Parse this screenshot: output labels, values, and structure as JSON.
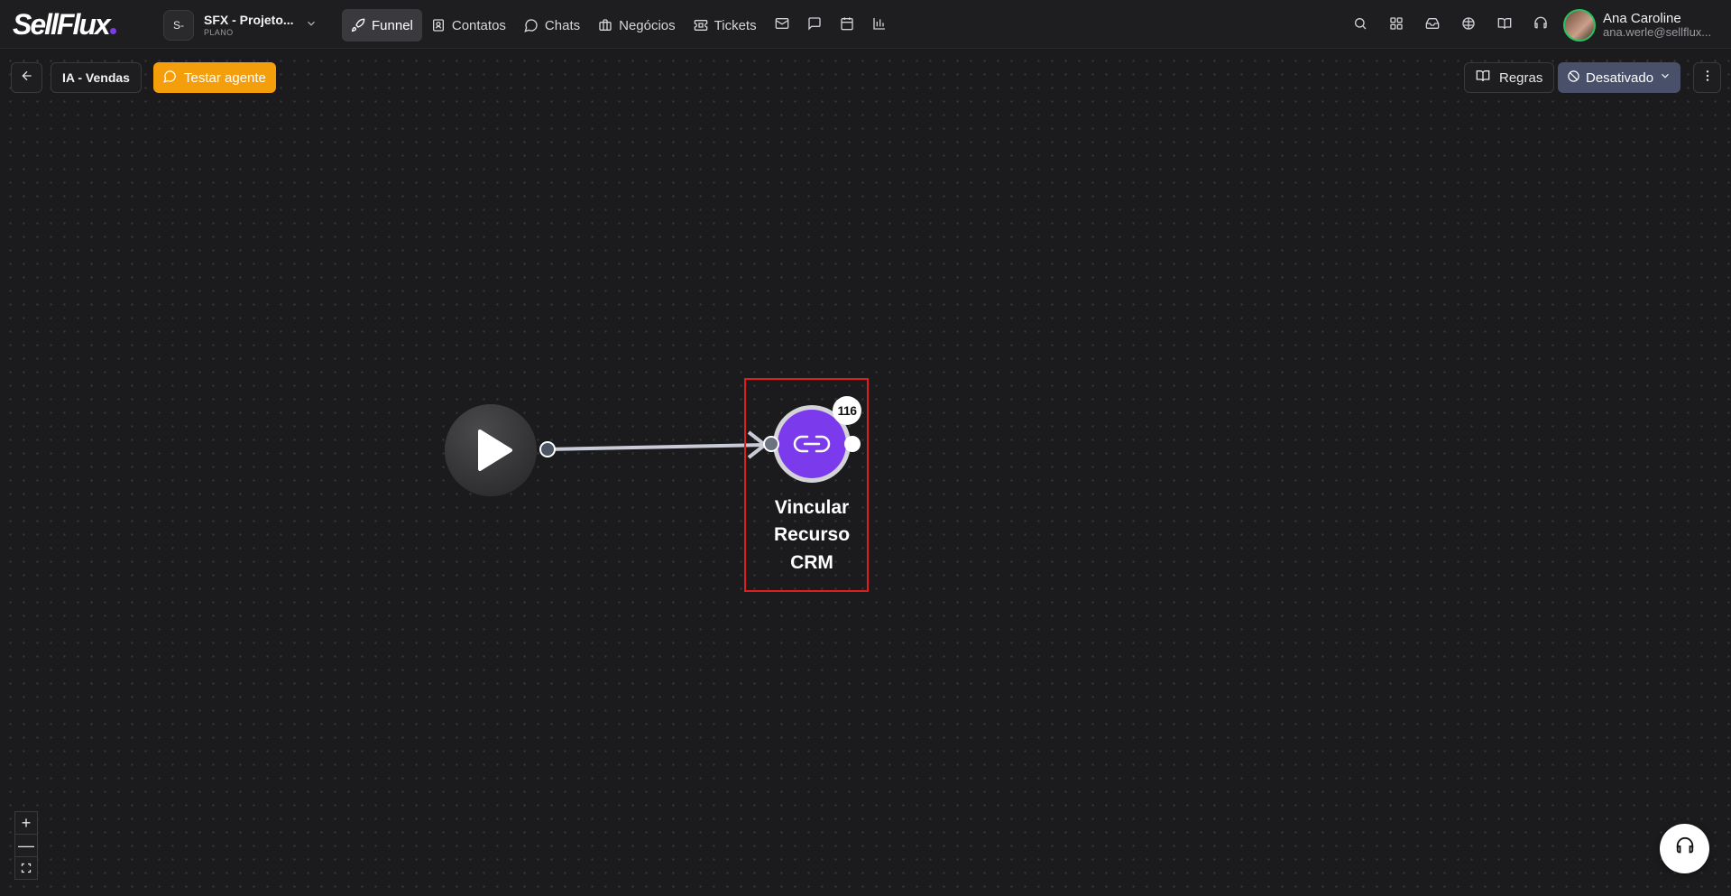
{
  "app": {
    "logo_text": "SellFlux",
    "accent": "#7c3aed"
  },
  "workspace": {
    "avatar_text": "S-",
    "name": "SFX - Projeto...",
    "plan": "PLANO"
  },
  "nav": {
    "funnel": "Funnel",
    "contatos": "Contatos",
    "chats": "Chats",
    "negocios": "Negócios",
    "tickets": "Tickets"
  },
  "user": {
    "name": "Ana Caroline",
    "email": "ana.werle@sellflux..."
  },
  "toolbar": {
    "title": "IA - Vendas",
    "test_label": "Testar agente",
    "rules_label": "Regras",
    "status_label": "Desativado",
    "test_color": "#f59e0b",
    "status_color": "#48506a"
  },
  "flow": {
    "start_node": "start-play",
    "action_node": {
      "label_line1": "Vincular",
      "label_line2": "Recurso",
      "label_line3": "CRM",
      "count": "116",
      "color": "#7c3aed"
    }
  },
  "zoom": {
    "in": "+",
    "out": "—",
    "fit": "⛶"
  }
}
